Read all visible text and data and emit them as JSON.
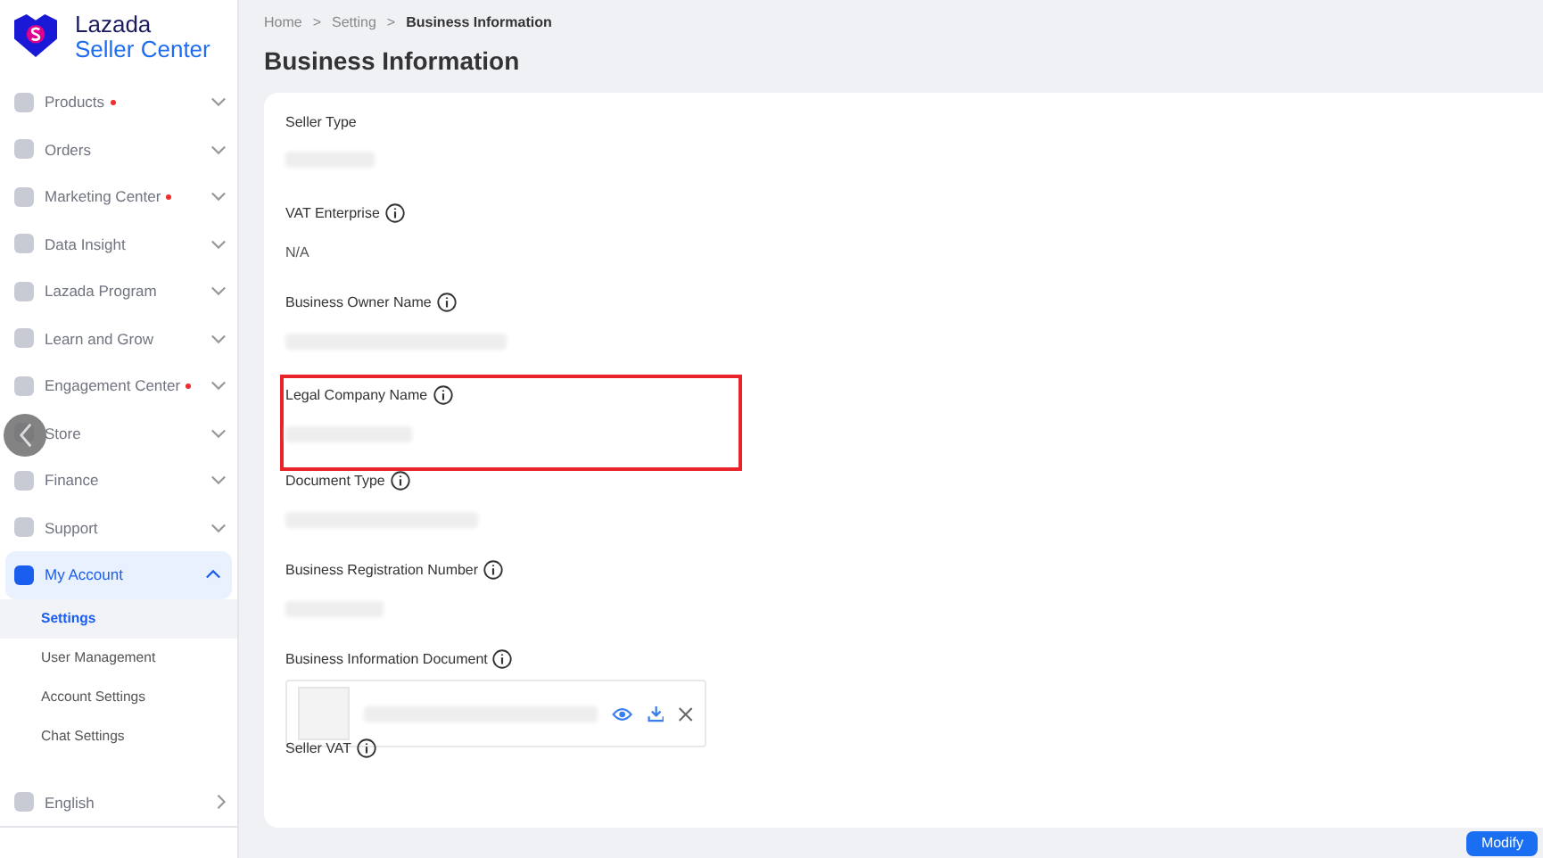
{
  "brand": {
    "name": "Lazada",
    "subtitle": "Seller Center"
  },
  "sidebar": {
    "items": [
      {
        "label": "Products",
        "badge": true,
        "expanded": false
      },
      {
        "label": "Orders",
        "badge": false,
        "expanded": false
      },
      {
        "label": "Marketing Center",
        "badge": true,
        "expanded": false
      },
      {
        "label": "Data Insight",
        "badge": false,
        "expanded": false
      },
      {
        "label": "Lazada Program",
        "badge": false,
        "expanded": false
      },
      {
        "label": "Learn and Grow",
        "badge": false,
        "expanded": false
      },
      {
        "label": "Engagement Center",
        "badge": true,
        "expanded": false
      },
      {
        "label": "Store",
        "badge": false,
        "expanded": false
      },
      {
        "label": "Finance",
        "badge": false,
        "expanded": false
      },
      {
        "label": "Support",
        "badge": false,
        "expanded": false
      },
      {
        "label": "My Account",
        "badge": false,
        "expanded": true,
        "children": [
          {
            "label": "Settings",
            "selected": true
          },
          {
            "label": "User Management",
            "selected": false
          },
          {
            "label": "Account Settings",
            "selected": false
          },
          {
            "label": "Chat Settings",
            "selected": false
          }
        ]
      }
    ],
    "language": "English"
  },
  "breadcrumb": [
    "Home",
    "Setting",
    "Business Information"
  ],
  "breadcrumb_separator": ">",
  "page_title": "Business Information",
  "fields": [
    {
      "kind": "redacted",
      "label": "Seller Type",
      "info": false,
      "highlighted": false
    },
    {
      "kind": "text",
      "label": "VAT Enterprise",
      "info": true,
      "value": "N/A",
      "highlighted": false
    },
    {
      "kind": "redacted",
      "label": "Business Owner Name",
      "info": true,
      "highlighted": false
    },
    {
      "kind": "redacted",
      "label": "Legal Company Name",
      "info": true,
      "highlighted": true
    },
    {
      "kind": "redacted",
      "label": "Document Type",
      "info": true,
      "highlighted": false
    },
    {
      "kind": "redacted",
      "label": "Business Registration Number",
      "info": true,
      "highlighted": false
    },
    {
      "kind": "document",
      "label": "Business Information Document",
      "info": true,
      "highlighted": false
    },
    {
      "kind": "empty",
      "label": "Seller VAT",
      "info": true,
      "highlighted": false
    }
  ],
  "modify_button": "Modify"
}
